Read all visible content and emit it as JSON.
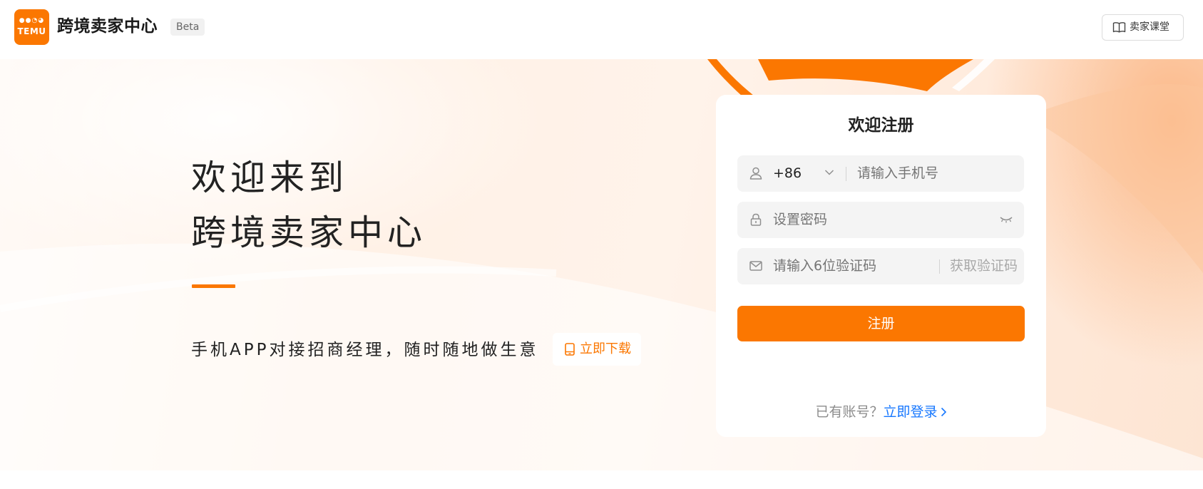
{
  "header": {
    "logo_word": "TEMU",
    "app_title": "跨境卖家中心",
    "badge": "Beta",
    "seller_class_label": "卖家课堂"
  },
  "hero": {
    "welcome_line1": "欢迎来到",
    "welcome_line2": "跨境卖家中心",
    "slogan": "手机APP对接招商经理，随时随地做生意",
    "download_label": "立即下载"
  },
  "register": {
    "title": "欢迎注册",
    "country_code": "+86",
    "phone_placeholder": "请输入手机号",
    "password_placeholder": "设置密码",
    "code_placeholder": "请输入6位验证码",
    "get_code_label": "获取验证码",
    "submit_label": "注册",
    "have_account_text": "已有账号？",
    "login_link": "立即登录"
  },
  "icons": {
    "user": "user-icon",
    "chevron": "chevron-down-icon",
    "lock": "lock-icon",
    "eye": "eye-closed-icon",
    "mail": "mail-icon",
    "book": "book-icon",
    "phone": "phone-icon"
  },
  "colors": {
    "brand": "#fb7701",
    "link": "#1677ff"
  }
}
